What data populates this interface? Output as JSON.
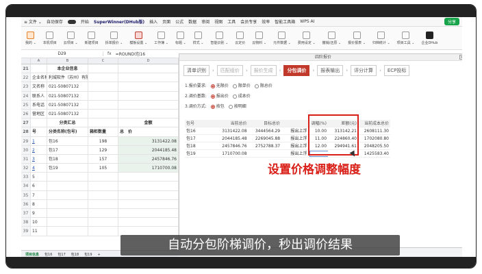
{
  "menubar": {
    "items": [
      "≡ 文件 ⌄",
      "自动保存",
      "开始",
      "插入",
      "页面",
      "公式",
      "数据",
      "审阅",
      "视图",
      "工具",
      "会员专享",
      "效率",
      "智能工具箱",
      "WPS AI"
    ],
    "brand": "SuperWinner(DHub版)",
    "share": "分享"
  },
  "ribbon": {
    "items": [
      "我的 ⌄",
      "本机项目",
      "云项目 ⌄",
      "新建项目",
      "拆单报价 ⌄",
      "模板设置 ⌄",
      "工作簿 ⌄",
      "标题 ⌄",
      "样式 ⌄",
      "智能识别 ⌄",
      "云定价",
      "云物料 ⌄",
      "元件数据 ⌄",
      "费用设定 ⌄",
      "撤销/还原 ⌄",
      "报价报表 ⌄",
      "归档统计 ⌄",
      "项目工具 ⌄",
      "企业DHub"
    ]
  },
  "formula": {
    "cell": "D29",
    "fx": "fx",
    "expr": "=ROUND(包16"
  },
  "sheet": {
    "columns": [
      "A",
      "B",
      "C",
      "D"
    ],
    "rows": [
      {
        "n": "21",
        "a": "",
        "b": "本企业信息",
        "c": "",
        "d": "",
        "style": "title"
      },
      {
        "n": "22",
        "a": "企业名称",
        "b": "利城软件（苏州）有限公司",
        "c": "",
        "d": ""
      },
      {
        "n": "23",
        "a": "文名称",
        "b": "021-50807132",
        "c": "",
        "d": ""
      },
      {
        "n": "24",
        "a": "联系人",
        "b": "021-50807132",
        "c": "",
        "d": ""
      },
      {
        "n": "25",
        "a": "系电话",
        "b": "021-50807132",
        "c": "",
        "d": ""
      },
      {
        "n": "26",
        "a": "营地区",
        "b": "021-50807132",
        "c": "",
        "d": ""
      },
      {
        "n": "27",
        "a": "",
        "b": "分类汇总",
        "c": "",
        "d": "金额",
        "style": "title"
      },
      {
        "n": "28",
        "a": "号",
        "b": "分类名称(包号)",
        "c": "箱柜数量",
        "d": "总　价",
        "style": "header"
      },
      {
        "n": "29",
        "a": "1",
        "b": "包16",
        "c": "198",
        "d": "3131422.08",
        "style": "data"
      },
      {
        "n": "30",
        "a": "2",
        "b": "包17",
        "c": "129",
        "d": "2044185.48",
        "style": "data"
      },
      {
        "n": "31",
        "a": "3",
        "b": "包18",
        "c": "157",
        "d": "2457846.76",
        "style": "data"
      },
      {
        "n": "32",
        "a": "4",
        "b": "包19",
        "c": "105",
        "d": "1710700.08",
        "style": "data"
      },
      {
        "n": "33",
        "a": "5",
        "b": "",
        "c": "",
        "d": ""
      },
      {
        "n": "34",
        "a": "6",
        "b": "",
        "c": "",
        "d": ""
      },
      {
        "n": "35",
        "a": "7",
        "b": "",
        "c": "",
        "d": ""
      },
      {
        "n": "36",
        "a": "8",
        "b": "",
        "c": "",
        "d": ""
      },
      {
        "n": "37",
        "a": "9",
        "b": "",
        "c": "",
        "d": ""
      },
      {
        "n": "38",
        "a": "10",
        "b": "",
        "c": "",
        "d": ""
      },
      {
        "n": "39",
        "a": "11",
        "b": "",
        "c": "",
        "d": ""
      }
    ],
    "tabs": [
      "项目信息",
      "包16",
      "包17",
      "包18",
      "包19",
      "+"
    ]
  },
  "dialog": {
    "title": "四阶报价",
    "close": "×",
    "steps": [
      {
        "label": "清单识别",
        "state": "normal"
      },
      {
        "label": "匹配组价",
        "state": "muted"
      },
      {
        "label": "报价生成",
        "state": "muted"
      },
      {
        "label": "分包调价",
        "state": "active"
      },
      {
        "label": "报表输出",
        "state": "normal"
      },
      {
        "label": "评分计算",
        "state": "normal"
      },
      {
        "label": "ECP投标",
        "state": "normal"
      }
    ],
    "options": [
      {
        "label": "1.报价要求:",
        "choices": [
          {
            "t": "无限价",
            "on": true
          },
          {
            "t": "限单价",
            "on": false
          },
          {
            "t": "限总价",
            "on": false
          }
        ]
      },
      {
        "label": "2.调价基数:",
        "choices": [
          {
            "t": "报出价",
            "on": true
          },
          {
            "t": "成本价",
            "on": false
          }
        ]
      },
      {
        "label": "3.调价方式:",
        "choices": [
          {
            "t": "按包",
            "on": true
          },
          {
            "t": "按明细",
            "on": false
          }
        ]
      }
    ],
    "table": {
      "headers": [
        "包号",
        "当前总价",
        "目标总价",
        "",
        "调幅(%)",
        "差额(元)",
        "当前成本总价"
      ],
      "rows": [
        [
          "包16",
          "3131422.08",
          "3444564.29",
          "报出上浮",
          "10.00",
          "313142.21",
          "2608111.30"
        ],
        [
          "包17",
          "2044185.48",
          "2269045.88",
          "报出上浮",
          "11.00",
          "224860.40",
          "1702080.80"
        ],
        [
          "包18",
          "2457846.76",
          "2752788.37",
          "报出上浮",
          "12.00",
          "294941.61",
          "2048205.50"
        ],
        [
          "包19",
          "1710700.08",
          "",
          "报出上浮",
          "",
          "",
          "1425583.40"
        ]
      ]
    }
  },
  "caption_red": "设置价格调整幅度",
  "subtitle": "自动分包阶梯调价，秒出调价结果"
}
